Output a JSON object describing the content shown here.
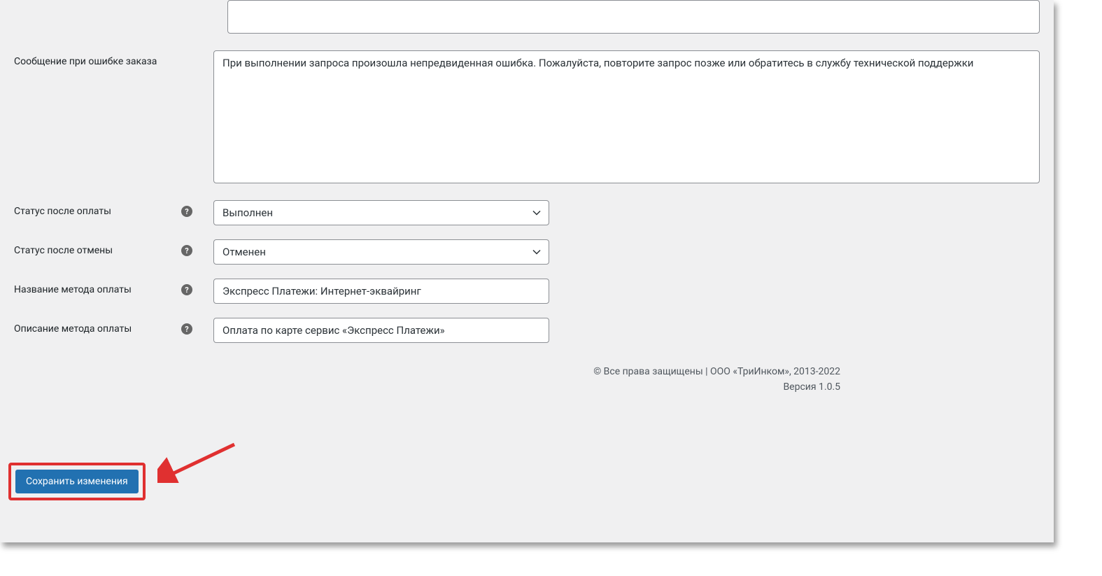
{
  "fields": {
    "error_message": {
      "label": "Сообщение при ошибке заказа",
      "value": "При выполнении запроса произошла непредвиденная ошибка. Пожалуйста, повторите запрос позже или обратитесь в службу технической поддержки"
    },
    "status_after_payment": {
      "label": "Статус после оплаты",
      "value": "Выполнен"
    },
    "status_after_cancel": {
      "label": "Статус после отмены",
      "value": "Отменен"
    },
    "payment_method_name": {
      "label": "Название метода оплаты",
      "value": "Экспресс Платежи: Интернет-эквайринг"
    },
    "payment_method_description": {
      "label": "Описание метода оплаты",
      "value": "Оплата по карте сервис «Экспресс Платежи»"
    }
  },
  "footer": {
    "copyright": "© Все права защищены | ООО «ТриИнком», 2013-2022",
    "version": "Версия 1.0.5"
  },
  "actions": {
    "save": "Сохранить изменения"
  }
}
